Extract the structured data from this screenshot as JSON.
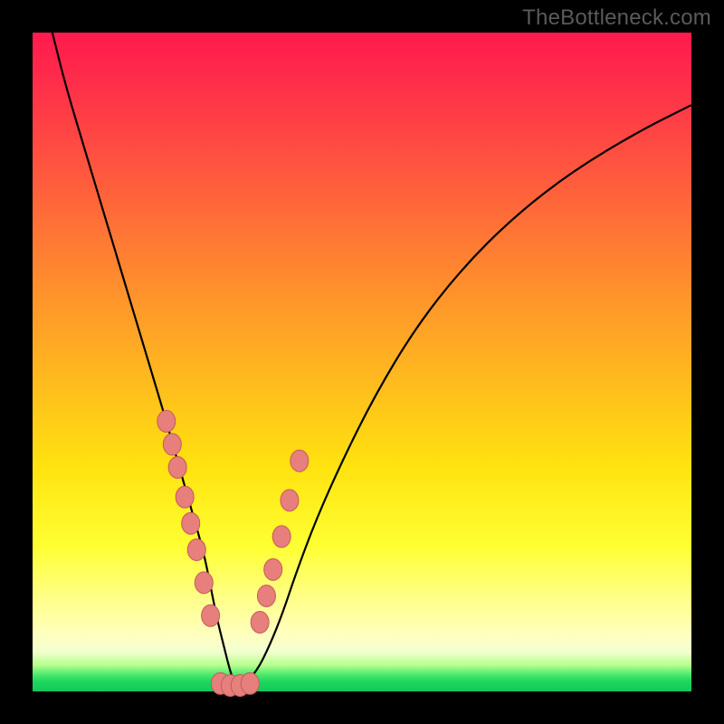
{
  "watermark": {
    "text": "TheBottleneck.com"
  },
  "colors": {
    "curve": "#000000",
    "marker_fill": "#e77f7d",
    "marker_stroke": "#c55b5a",
    "frame": "#000000"
  },
  "chart_data": {
    "type": "line",
    "title": "",
    "xlabel": "",
    "ylabel": "",
    "xlim": [
      0,
      100
    ],
    "ylim": [
      0,
      100
    ],
    "grid": false,
    "series": [
      {
        "name": "bottleneck-curve",
        "x": [
          3,
          5,
          8,
          11,
          14,
          17,
          20,
          22,
          24,
          26,
          27,
          28,
          29,
          30,
          30.8,
          31.8,
          34,
          36,
          38,
          40,
          43,
          47,
          52,
          58,
          65,
          73,
          82,
          92,
          100
        ],
        "y": [
          100,
          92,
          82,
          72,
          62,
          52,
          42,
          35,
          28,
          21,
          16,
          11,
          7,
          3,
          0.8,
          0.8,
          3,
          7,
          12,
          18,
          26,
          35,
          45,
          55,
          64,
          72,
          79,
          85,
          89
        ]
      }
    ],
    "markers": [
      {
        "name": "left-band",
        "x": [
          20.3,
          21.2,
          22.0,
          23.1,
          24.0,
          24.9,
          26.0,
          27.0
        ],
        "y": [
          41.0,
          37.5,
          34.0,
          29.5,
          25.5,
          21.5,
          16.5,
          11.5
        ]
      },
      {
        "name": "valley",
        "x": [
          28.5,
          30.0,
          31.5,
          33.0
        ],
        "y": [
          1.2,
          0.9,
          0.9,
          1.2
        ]
      },
      {
        "name": "right-band",
        "x": [
          34.5,
          35.5,
          36.5,
          37.8,
          39.0,
          40.5
        ],
        "y": [
          10.5,
          14.5,
          18.5,
          23.5,
          29.0,
          35.0
        ]
      }
    ],
    "legend": null
  }
}
